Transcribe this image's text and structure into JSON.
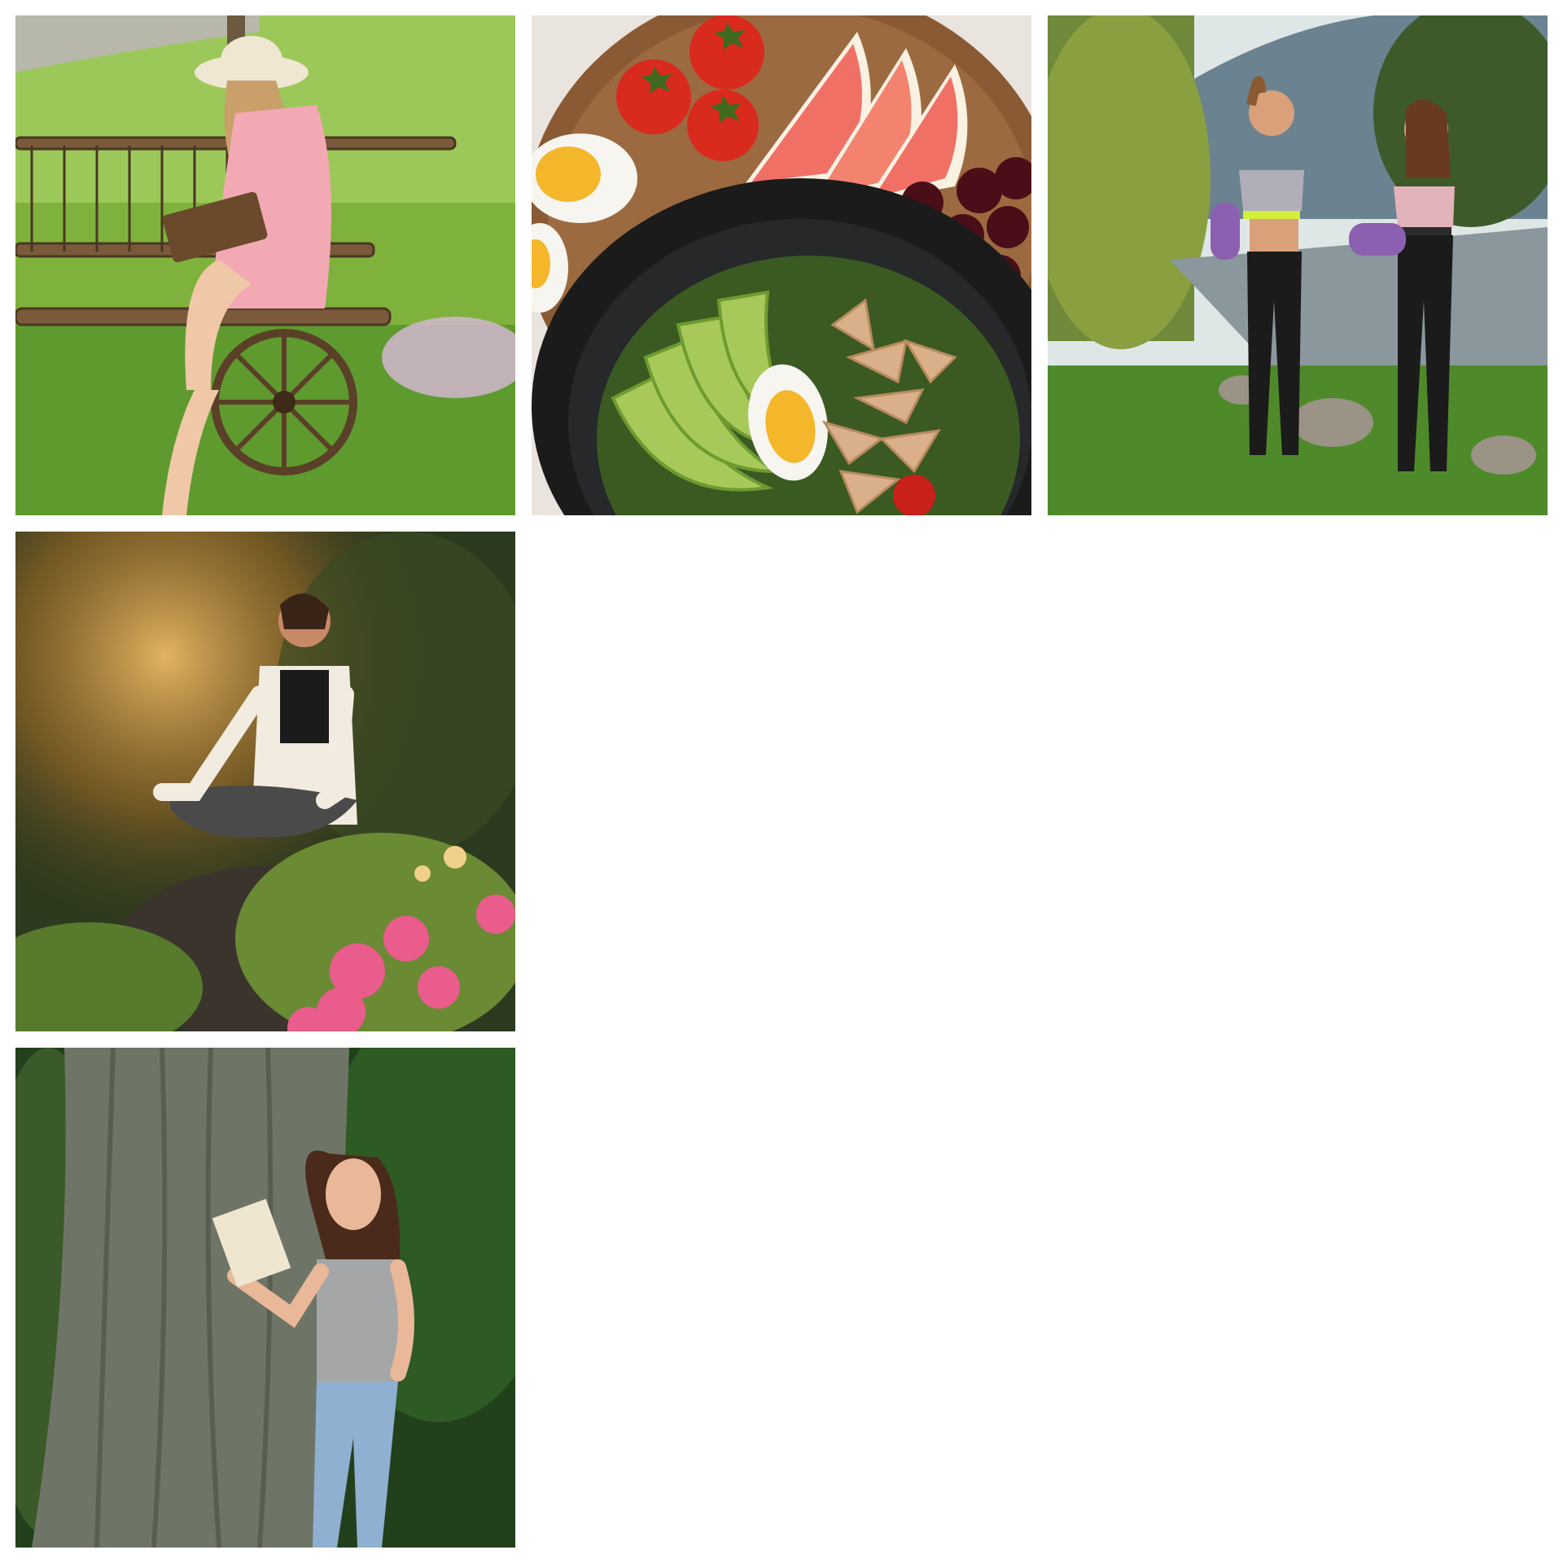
{
  "gallery": {
    "columns": 3,
    "tiles": [
      {
        "id": "reading-cart",
        "subject": "girl-reading-on-wooden-cart"
      },
      {
        "id": "food-bowl",
        "subject": "salad-bowl-with-avocado-egg-grapefruit"
      },
      {
        "id": "yoga-walkers",
        "subject": "two-women-with-yoga-mats-by-river"
      },
      {
        "id": "meditation",
        "subject": "woman-meditating-on-rock"
      },
      {
        "id": "tree-reader",
        "subject": "woman-reading-against-tree"
      }
    ]
  },
  "colors": {
    "background": "#ffffff",
    "grass": "#5f9a2e",
    "wood": "#7a5a3a",
    "avocado": "#a6c95a",
    "grapefruit": "#f07066",
    "leggings": "#1b1b1b",
    "forest": "#2c3a1f",
    "bark": "#6f7566"
  }
}
